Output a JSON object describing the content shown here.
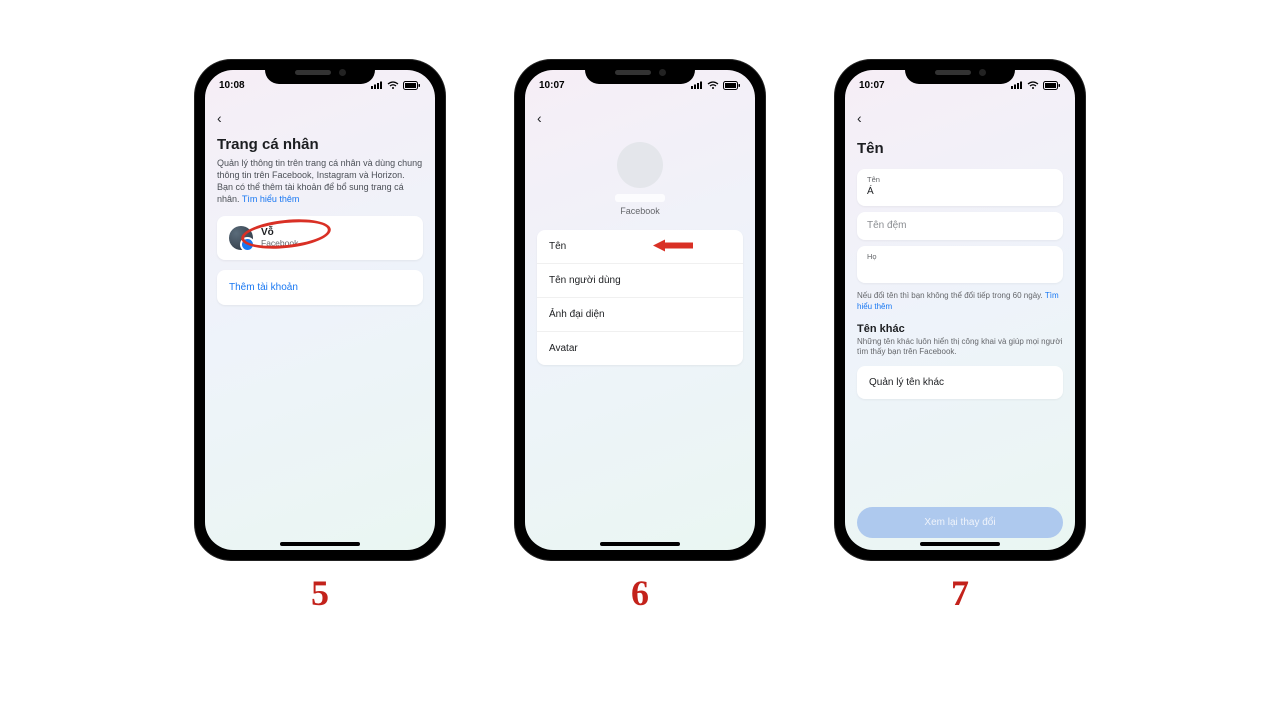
{
  "steps": [
    "5",
    "6",
    "7"
  ],
  "statusbar": {
    "time1": "10:08",
    "time2": "10:07",
    "time3": "10:07"
  },
  "phone1": {
    "title": "Trang cá nhân",
    "desc_prefix": "Quản lý thông tin trên trang cá nhân và dùng chung thông tin trên Facebook, Instagram và Horizon. Bạn có thể thêm tài khoản để bổ sung trang cá nhân. ",
    "learn_more": "Tìm hiểu thêm",
    "account_name": "Vỗ",
    "account_platform": "Facebook",
    "add_account": "Thêm tài khoản"
  },
  "phone2": {
    "platform": "Facebook",
    "items": [
      "Tên",
      "Tên người dùng",
      "Ảnh đại diện",
      "Avatar"
    ]
  },
  "phone3": {
    "title": "Tên",
    "field_firstname_label": "Tên",
    "field_firstname_value": "Á",
    "field_middlename_placeholder": "Tên đệm",
    "field_lastname_label": "Họ",
    "note_prefix": "Nếu đổi tên thì bạn không thể đổi tiếp trong 60 ngày. ",
    "note_link": "Tìm hiểu thêm",
    "other_names_title": "Tên khác",
    "other_names_sub": "Những tên khác luôn hiển thị công khai và giúp mọi người tìm thấy bạn trên Facebook.",
    "manage_other": "Quản lý tên khác",
    "review_btn": "Xem lại thay đổi"
  }
}
